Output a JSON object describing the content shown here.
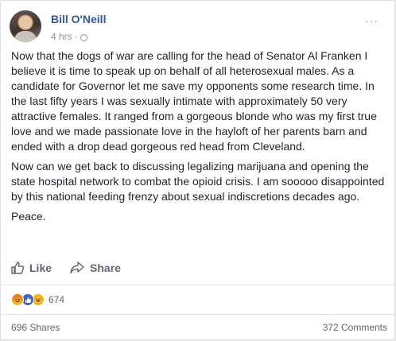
{
  "post": {
    "author": "Bill O'Neill",
    "time": "4 hrs",
    "separator": "·",
    "menu": "···",
    "paragraphs": [
      "Now that the dogs of war are calling for the head of Senator Al Franken I believe it is time to speak up on behalf of all heterosexual males. As a candidate for Governor let me save my opponents some research time. In the last fifty years I was sexually intimate with approximately 50 very attractive females. It ranged from a gorgeous blonde who was my first true love and we made passionate love in the hayloft of her parents barn and ended with a drop dead gorgeous red head from Cleveland.",
      "Now can we get back to discussing legalizing marijuana and opening the state hospital network to combat the opioid crisis. I am sooooo disappointed by this national feeding frenzy about sexual indiscretions decades ago.",
      "Peace."
    ]
  },
  "actions": {
    "like_label": "Like",
    "share_label": "Share"
  },
  "reactions": {
    "icons": [
      "angry-reaction-icon",
      "like-reaction-icon",
      "haha-reaction-icon"
    ],
    "count": "674"
  },
  "footer": {
    "shares": "696 Shares",
    "comments": "372 Comments"
  },
  "colors": {
    "author": "#365899",
    "text": "#1d2129",
    "muted": "#90949c",
    "like_blue": "#4267b2"
  }
}
